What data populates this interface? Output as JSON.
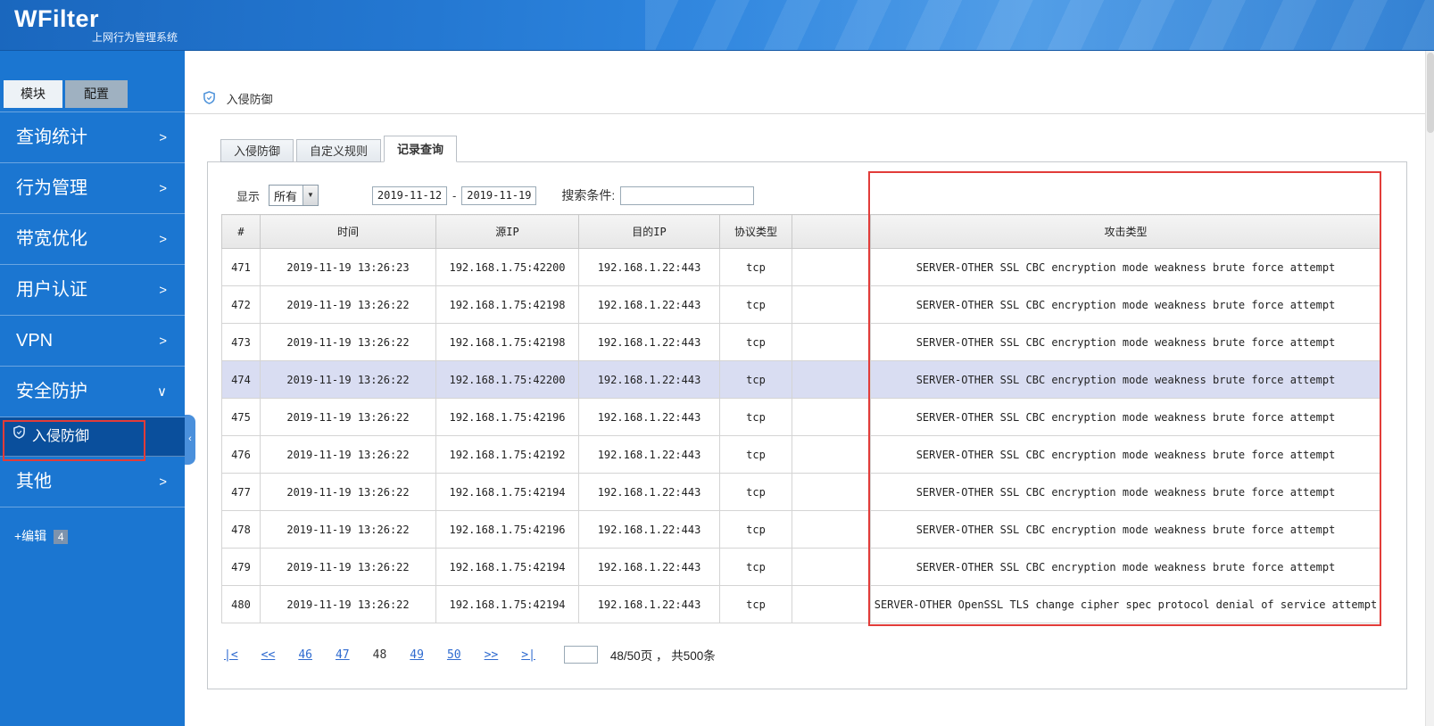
{
  "header": {
    "logo": "WFilter",
    "subtitle": "上网行为管理系统"
  },
  "sidebar": {
    "tabs": [
      {
        "label": "模块",
        "active": true
      },
      {
        "label": "配置",
        "active": false
      }
    ],
    "items": [
      {
        "label": "查询统计",
        "chevron": ">"
      },
      {
        "label": "行为管理",
        "chevron": ">"
      },
      {
        "label": "带宽优化",
        "chevron": ">"
      },
      {
        "label": "用户认证",
        "chevron": ">"
      },
      {
        "label": "VPN",
        "chevron": ">"
      },
      {
        "label": "安全防护",
        "chevron": "∨",
        "expanded": true
      },
      {
        "label": "入侵防御",
        "submenu": true,
        "selected": true,
        "icon": "intrusion-shield"
      },
      {
        "label": "其他",
        "chevron": ">"
      }
    ],
    "edit_label": "+编辑",
    "edit_badge": "4",
    "collapse_arrow": "‹"
  },
  "breadcrumb": {
    "icon": "intrusion-shield",
    "label": "入侵防御"
  },
  "content_tabs": [
    {
      "label": "入侵防御",
      "active": false
    },
    {
      "label": "自定义规则",
      "active": false
    },
    {
      "label": "记录查询",
      "active": true
    }
  ],
  "filters": {
    "display_label": "显示",
    "display_value": "所有",
    "dropdown_arrow": "▼",
    "date_from": "2019-11-12",
    "date_separator": "-",
    "date_to": "2019-11-19",
    "search_label": "搜索条件:",
    "search_value": ""
  },
  "table": {
    "columns": [
      "#",
      "时间",
      "源IP",
      "目的IP",
      "协议类型",
      "",
      "攻击类型"
    ],
    "highlighted_row": 3,
    "rows": [
      [
        "471",
        "2019-11-19 13:26:23",
        "192.168.1.75:42200",
        "192.168.1.22:443",
        "tcp",
        "",
        "SERVER-OTHER SSL CBC encryption mode weakness brute force attempt"
      ],
      [
        "472",
        "2019-11-19 13:26:22",
        "192.168.1.75:42198",
        "192.168.1.22:443",
        "tcp",
        "",
        "SERVER-OTHER SSL CBC encryption mode weakness brute force attempt"
      ],
      [
        "473",
        "2019-11-19 13:26:22",
        "192.168.1.75:42198",
        "192.168.1.22:443",
        "tcp",
        "",
        "SERVER-OTHER SSL CBC encryption mode weakness brute force attempt"
      ],
      [
        "474",
        "2019-11-19 13:26:22",
        "192.168.1.75:42200",
        "192.168.1.22:443",
        "tcp",
        "",
        "SERVER-OTHER SSL CBC encryption mode weakness brute force attempt"
      ],
      [
        "475",
        "2019-11-19 13:26:22",
        "192.168.1.75:42196",
        "192.168.1.22:443",
        "tcp",
        "",
        "SERVER-OTHER SSL CBC encryption mode weakness brute force attempt"
      ],
      [
        "476",
        "2019-11-19 13:26:22",
        "192.168.1.75:42192",
        "192.168.1.22:443",
        "tcp",
        "",
        "SERVER-OTHER SSL CBC encryption mode weakness brute force attempt"
      ],
      [
        "477",
        "2019-11-19 13:26:22",
        "192.168.1.75:42194",
        "192.168.1.22:443",
        "tcp",
        "",
        "SERVER-OTHER SSL CBC encryption mode weakness brute force attempt"
      ],
      [
        "478",
        "2019-11-19 13:26:22",
        "192.168.1.75:42196",
        "192.168.1.22:443",
        "tcp",
        "",
        "SERVER-OTHER SSL CBC encryption mode weakness brute force attempt"
      ],
      [
        "479",
        "2019-11-19 13:26:22",
        "192.168.1.75:42194",
        "192.168.1.22:443",
        "tcp",
        "",
        "SERVER-OTHER SSL CBC encryption mode weakness brute force attempt"
      ],
      [
        "480",
        "2019-11-19 13:26:22",
        "192.168.1.75:42194",
        "192.168.1.22:443",
        "tcp",
        "",
        "SERVER-OTHER OpenSSL TLS change cipher spec protocol denial of service attempt"
      ]
    ]
  },
  "pagination": {
    "first": "|<",
    "prev": "<<",
    "pages": [
      "46",
      "47",
      "48",
      "49",
      "50"
    ],
    "current": "48",
    "next": ">>",
    "last": ">|",
    "jump_value": "",
    "info": "48/50页 ，  共500条"
  }
}
